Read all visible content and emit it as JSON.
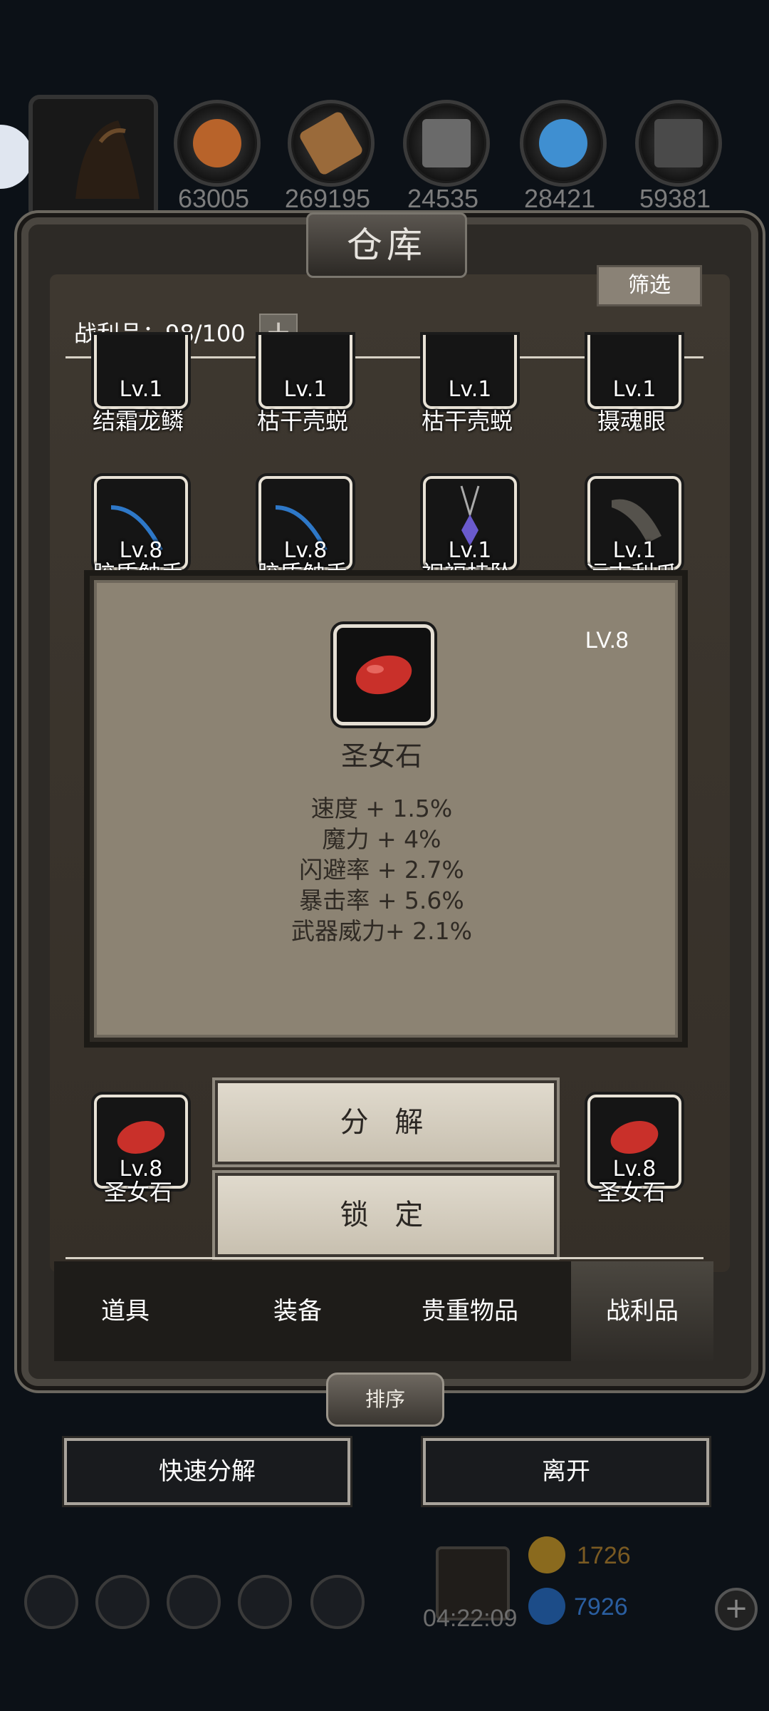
{
  "resources": [
    {
      "name": "meat",
      "count": "63005",
      "color": "#b8632a",
      "icon": "meat-icon"
    },
    {
      "name": "wood",
      "count": "269195",
      "color": "#9a6a3a",
      "icon": "wood-icon"
    },
    {
      "name": "iron",
      "count": "24535",
      "color": "#7a7a7a",
      "icon": "iron-ingot-icon"
    },
    {
      "name": "crystal",
      "count": "28421",
      "color": "#3f8fd1",
      "icon": "crystal-icon"
    },
    {
      "name": "stone",
      "count": "59381",
      "color": "#5a5a5a",
      "icon": "stone-icon"
    }
  ],
  "window": {
    "title": "仓库",
    "filter_label": "筛选",
    "loot_label": "战利品：98/100",
    "add_symbol": "+"
  },
  "grid_rows": [
    [
      {
        "name": "结霜龙鳞",
        "level": "Lv.1",
        "icon": "frost-scale-icon"
      },
      {
        "name": "枯干壳蜕",
        "level": "Lv.1",
        "icon": "husk-icon"
      },
      {
        "name": "枯干壳蜕",
        "level": "Lv.1",
        "icon": "husk-icon"
      },
      {
        "name": "摄魂眼",
        "level": "Lv.1",
        "icon": "soul-eye-icon"
      }
    ],
    [
      {
        "name": "胶质触手",
        "level": "Lv.8",
        "icon": "tentacle-icon"
      },
      {
        "name": "胶质触手",
        "level": "Lv.8",
        "icon": "tentacle-icon"
      },
      {
        "name": "祝福挂坠",
        "level": "Lv.1",
        "icon": "pendant-icon"
      },
      {
        "name": "远古利爪",
        "level": "Lv.1",
        "icon": "claw-icon"
      }
    ],
    [
      {
        "name": "圣女石",
        "level": "Lv.8",
        "icon": "red-stone-icon"
      },
      {
        "name": "圣女石",
        "level": "Lv.8",
        "icon": "red-stone-icon"
      },
      {
        "name": "圣女石",
        "level": "Lv.8",
        "icon": "red-stone-icon"
      },
      {
        "name": "圣女石",
        "level": "Lv.8",
        "icon": "red-stone-icon"
      }
    ]
  ],
  "tooltip": {
    "level": "LV.8",
    "name": "圣女石",
    "icon": "red-stone-icon",
    "stats": [
      "速度 + 1.5%",
      "魔力 + 4%",
      "闪避率 + 2.7%",
      "暴击率 + 5.6%",
      "武器威力+ 2.1%"
    ]
  },
  "actions": {
    "decompose": "分 解",
    "lock": "锁 定"
  },
  "tabs": [
    "道具",
    "装备",
    "贵重物品",
    "战利品"
  ],
  "active_tab": "战利品",
  "sort_label": "排序",
  "bottom_buttons": {
    "quick_decompose": "快速分解",
    "leave": "离开"
  },
  "hud": {
    "timer": "04:22:09",
    "gold": "1726",
    "gems": "7926",
    "plus": "+"
  }
}
